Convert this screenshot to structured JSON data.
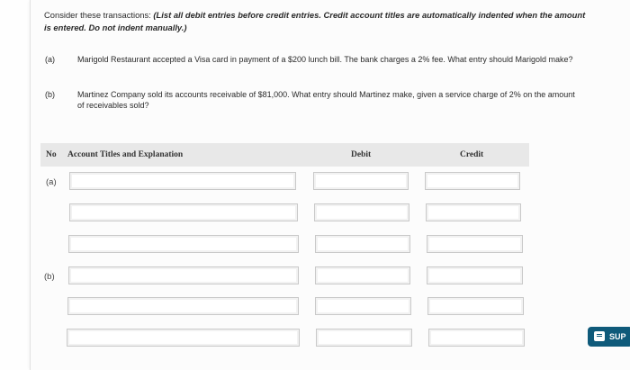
{
  "instructions": {
    "lead": "Consider these transactions: ",
    "emphasis": "(List all debit entries before credit entries. Credit account titles are automatically indented when the amount is entered. Do not indent manually.)"
  },
  "questions": [
    {
      "label": "(a)",
      "text": "Marigold Restaurant accepted a Visa card in payment of a $200 lunch bill. The bank charges a 2% fee. What entry should Marigold make?"
    },
    {
      "label": "(b)",
      "text": "Martinez Company sold its accounts receivable of $81,000. What entry should Martinez make, given a service charge of 2% on the amount of receivables sold?"
    }
  ],
  "table": {
    "headers": {
      "no": "No",
      "account": "Account Titles and Explanation",
      "debit": "Debit",
      "credit": "Credit"
    },
    "rows": [
      {
        "label": "(a)",
        "account": "",
        "debit": "",
        "credit": ""
      },
      {
        "label": "",
        "account": "",
        "debit": "",
        "credit": ""
      },
      {
        "label": "",
        "account": "",
        "debit": "",
        "credit": ""
      },
      {
        "label": "(b)",
        "account": "",
        "debit": "",
        "credit": ""
      },
      {
        "label": "",
        "account": "",
        "debit": "",
        "credit": ""
      },
      {
        "label": "",
        "account": "",
        "debit": "",
        "credit": ""
      }
    ]
  },
  "support_button": {
    "label": "SUP",
    "icon": "chat-icon",
    "color": "#0f5a7a"
  }
}
